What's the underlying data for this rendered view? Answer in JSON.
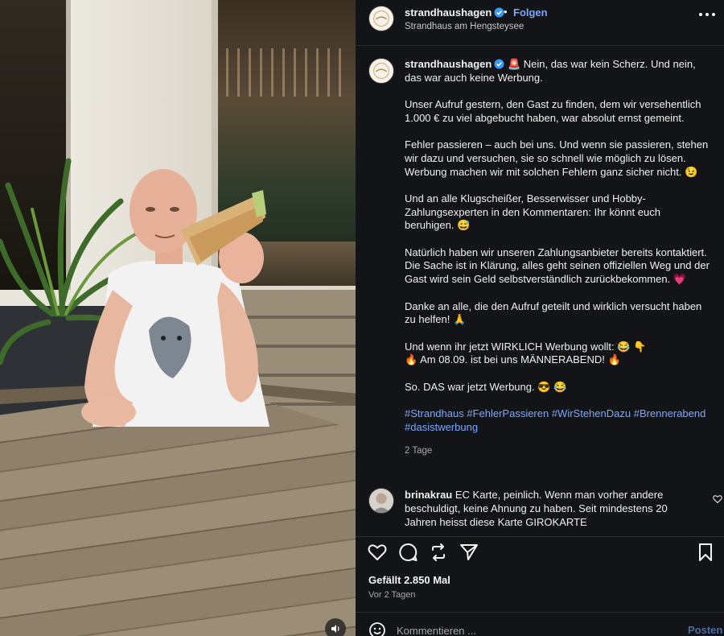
{
  "post": {
    "username": "strandhaushagen",
    "follow_label": "Folgen",
    "separator": "•",
    "location": "Strandhaus am Hengsteysee",
    "caption": {
      "line1": "Nein, das war kein Scherz. Und nein, das war auch keine Werbung.",
      "p2": "Unser Aufruf gestern, den Gast zu finden, dem wir versehentlich 1.000 € zu viel abgebucht haben, war absolut ernst gemeint.",
      "p3": "Fehler passieren – auch bei uns. Und wenn sie passieren, stehen wir dazu und versuchen, sie so schnell wie möglich zu lösen. Werbung machen wir mit solchen Fehlern ganz sicher nicht.",
      "p4": "Und an alle Klugscheißer, Besserwisser und Hobby-Zahlungsexperten in den Kommentaren: Ihr könnt euch beruhigen.",
      "p5": "Natürlich haben wir unseren Zahlungsanbieter bereits kontaktiert. Die Sache ist in Klärung, alles geht seinen offiziellen Weg und der Gast wird sein Geld selbstverständlich zurückbekommen.",
      "p6": "Danke an alle, die den Aufruf geteilt und wirklich versucht haben zu helfen!",
      "p7a": "Und wenn ihr jetzt WIRKLICH Werbung wollt:",
      "p7b": "Am 08.09. ist bei uns MÄNNERABEND!",
      "p8": "So. DAS war jetzt Werbung.",
      "hashtags": "#Strandhaus #FehlerPassieren #WirStehenDazu #Brennerabend #dasistwerbung",
      "age": "2 Tage"
    },
    "emoji": {
      "siren": "🚨",
      "wink": "😉",
      "grin": "😅",
      "heart": "💗",
      "pray": "🙏",
      "laugh": "😂",
      "point_down": "👇",
      "fire": "🔥",
      "cool": "😎"
    }
  },
  "comment": {
    "username": "brinakrau",
    "text": "EC Karte, peinlich. Wenn man vorher andere beschuldigt, keine Ahnung zu haben. Seit mindestens 20 Jahren heisst diese Karte GIROKARTE"
  },
  "stats": {
    "likes": "Gefällt 2.850 Mal",
    "date": "Vor 2 Tagen"
  },
  "composer": {
    "placeholder": "Kommentieren ...",
    "post_label": "Posten"
  },
  "colors": {
    "panel_bg": "#121417",
    "link": "#7aa8ff",
    "muted": "#a8a8a8"
  }
}
